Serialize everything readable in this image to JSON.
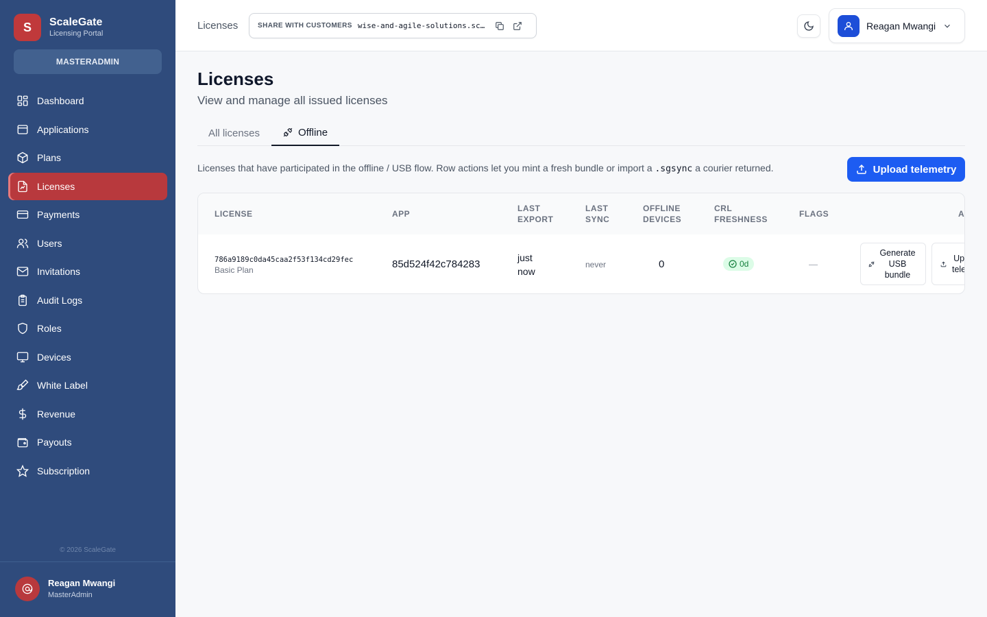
{
  "brand": {
    "initial": "S",
    "name": "ScaleGate",
    "subtitle": "Licensing Portal"
  },
  "role_pill": "MASTERADMIN",
  "sidebar": {
    "items": [
      {
        "label": "Dashboard",
        "icon": "dashboard-icon"
      },
      {
        "label": "Applications",
        "icon": "applications-icon"
      },
      {
        "label": "Plans",
        "icon": "box-icon"
      },
      {
        "label": "Licenses",
        "icon": "license-icon",
        "active": true
      },
      {
        "label": "Payments",
        "icon": "credit-card-icon"
      },
      {
        "label": "Users",
        "icon": "users-icon"
      },
      {
        "label": "Invitations",
        "icon": "mail-icon"
      },
      {
        "label": "Audit Logs",
        "icon": "clipboard-icon"
      },
      {
        "label": "Roles",
        "icon": "shield-icon"
      },
      {
        "label": "Devices",
        "icon": "monitor-icon"
      },
      {
        "label": "White Label",
        "icon": "brush-icon"
      },
      {
        "label": "Revenue",
        "icon": "dollar-icon"
      },
      {
        "label": "Payouts",
        "icon": "wallet-icon"
      },
      {
        "label": "Subscription",
        "icon": "star-icon"
      }
    ],
    "copyright": "© 2026 ScaleGate",
    "user": {
      "name": "Reagan Mwangi",
      "role": "MasterAdmin"
    }
  },
  "topbar": {
    "breadcrumb": "Licenses",
    "share_label": "SHARE WITH CUSTOMERS",
    "share_url": "wise-and-agile-solutions.scaleg",
    "user_name": "Reagan Mwangi"
  },
  "page": {
    "title": "Licenses",
    "subtitle": "View and manage all issued licenses",
    "tabs": [
      {
        "label": "All licenses"
      },
      {
        "label": "Offline",
        "active": true
      }
    ],
    "description_before": "Licenses that have participated in the offline / USB flow. Row actions let you mint a fresh bundle or import a ",
    "description_code": ".sgsync",
    "description_after": " a courier returned.",
    "upload_button": "Upload telemetry"
  },
  "table": {
    "headers": {
      "license": "LICENSE",
      "app": "APP",
      "last_export_1": "LAST",
      "last_export_2": "EXPORT",
      "last_sync_1": "LAST",
      "last_sync_2": "SYNC",
      "offline_devices_1": "OFFLINE",
      "offline_devices_2": "DEVICES",
      "crl_1": "CRL",
      "crl_2": "FRESHNESS",
      "flags": "FLAGS",
      "actions": "A"
    },
    "rows": [
      {
        "license_id": "786a9189c0da45caa2f53f134cd29fec",
        "plan": "Basic Plan",
        "app": "85d524f42c784283",
        "last_export": "just now",
        "last_sync": "never",
        "offline_devices": "0",
        "crl_freshness": "0d",
        "flags": "—",
        "action_generate": "Generate USB bundle",
        "action_upload_1": "Up",
        "action_upload_2": "tele"
      }
    ]
  },
  "colors": {
    "sidebar": "#2f4b7c",
    "accent_red": "#b8393d",
    "primary_blue": "#1d5cf2",
    "success_green": "#15803d"
  }
}
